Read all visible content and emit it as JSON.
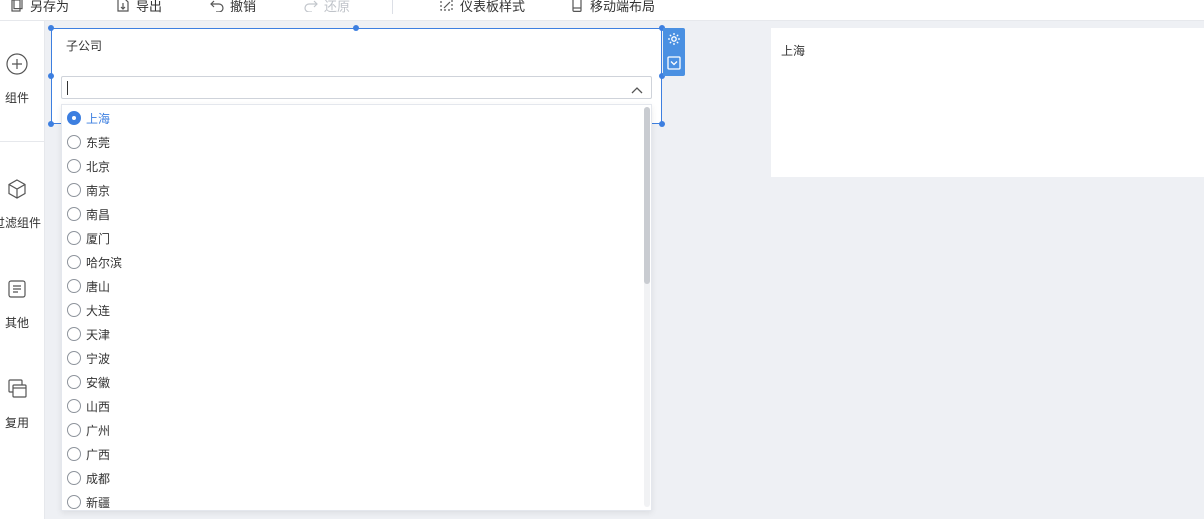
{
  "toolbar": {
    "items": [
      {
        "label": "另存为",
        "icon": "save-as-icon"
      },
      {
        "label": "导出",
        "icon": "export-icon"
      },
      {
        "label": "撤销",
        "icon": "undo-icon"
      },
      {
        "label": "还原",
        "icon": "redo-icon",
        "disabled": true
      },
      {
        "label": "仪表板样式",
        "icon": "dashboard-style-icon"
      },
      {
        "label": "移动端布局",
        "icon": "mobile-layout-icon"
      }
    ]
  },
  "sidebar": {
    "items": [
      {
        "label": "组件",
        "icon": "add-circle-icon"
      },
      {
        "label": "过滤组件",
        "icon": "cube-icon"
      },
      {
        "label": "其他",
        "icon": "document-icon"
      },
      {
        "label": "复用",
        "icon": "copy-window-icon"
      }
    ]
  },
  "widget": {
    "title": "子公司",
    "select_value": "",
    "actions": [
      {
        "icon": "gear-icon"
      },
      {
        "icon": "collapse-icon"
      }
    ],
    "options": [
      "上海",
      "东莞",
      "北京",
      "南京",
      "南昌",
      "厦门",
      "哈尔滨",
      "唐山",
      "大连",
      "天津",
      "宁波",
      "安徽",
      "山西",
      "广州",
      "广西",
      "成都",
      "新疆"
    ],
    "selected": "上海"
  },
  "card": {
    "text": "上海"
  },
  "colors": {
    "accent": "#3d7fe0",
    "canvas": "#eef0f4"
  }
}
